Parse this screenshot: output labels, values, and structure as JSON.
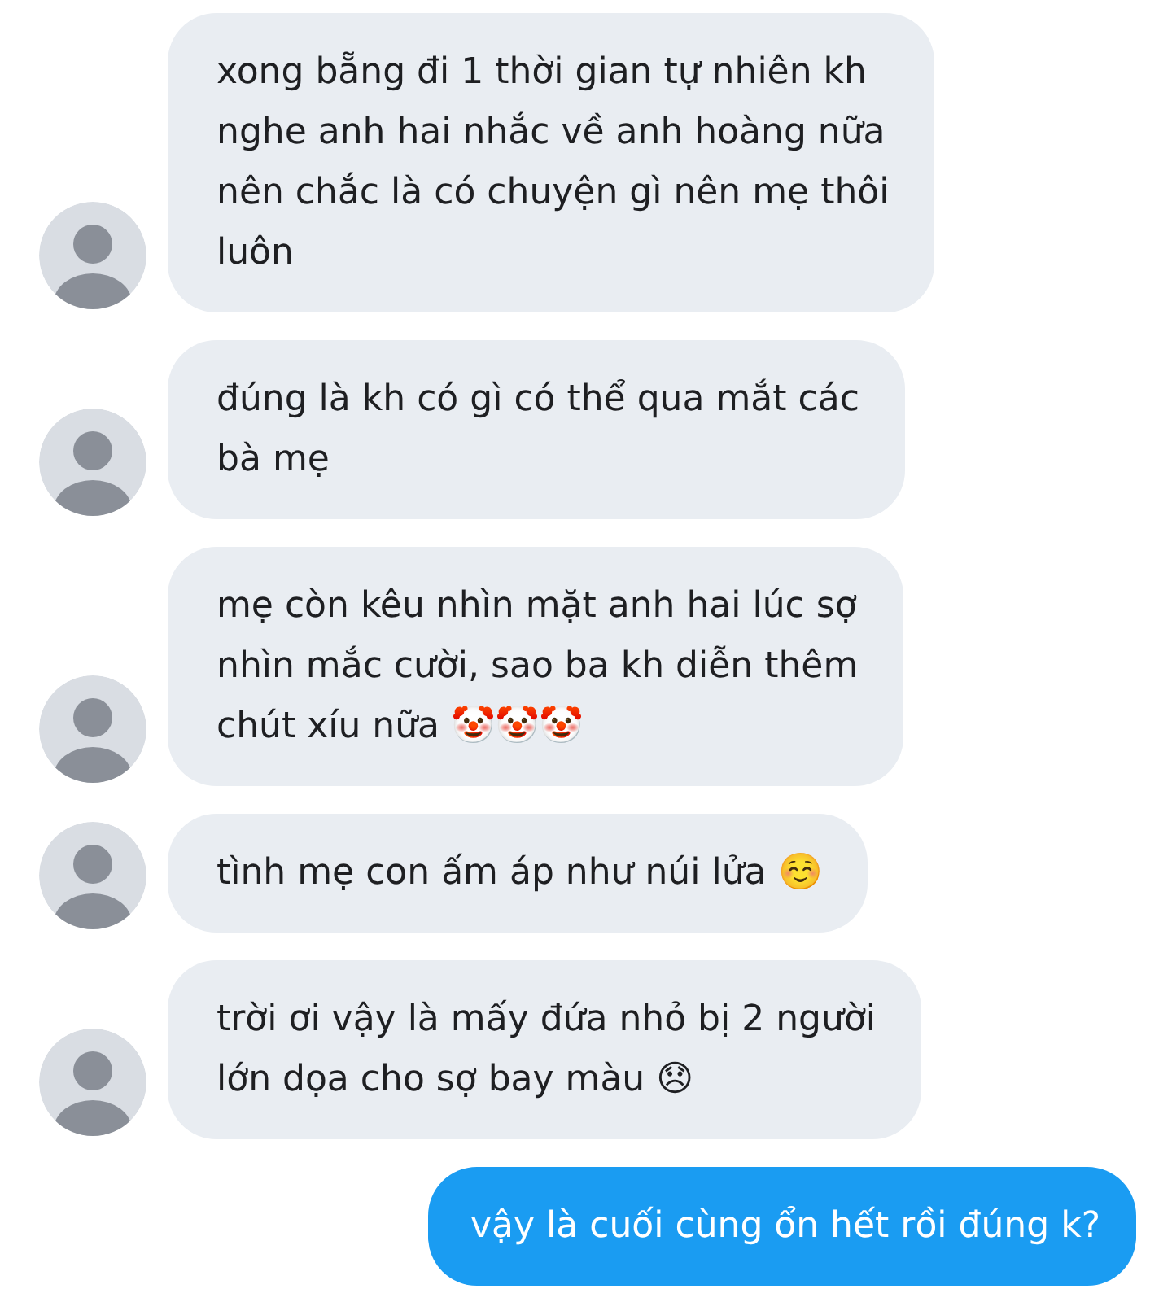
{
  "messages": [
    {
      "kind": "incoming",
      "text": "xong bẵng đi 1 thời gian tự nhiên kh\nnghe anh hai nhắc về anh hoàng nữa\nnên chắc là có chuyện gì nên mẹ thôi\nluôn"
    },
    {
      "kind": "incoming",
      "text": "đúng là kh có gì có thể qua mắt các\nbà mẹ"
    },
    {
      "kind": "incoming",
      "text": "mẹ còn kêu nhìn mặt anh hai lúc sợ\nnhìn mắc cười, sao ba kh diễn thêm\nchút xíu nữa 🤡🤡🤡"
    },
    {
      "kind": "incoming",
      "text": "tình mẹ con ấm áp như núi lửa ☺️"
    },
    {
      "kind": "incoming",
      "text": "trời ơi vậy là mấy đứa nhỏ bị 2 người\nlớn dọa cho sợ bay màu 😞"
    },
    {
      "kind": "outgoing",
      "text": "vậy là cuối cùng ổn hết rồi đúng k?"
    }
  ]
}
